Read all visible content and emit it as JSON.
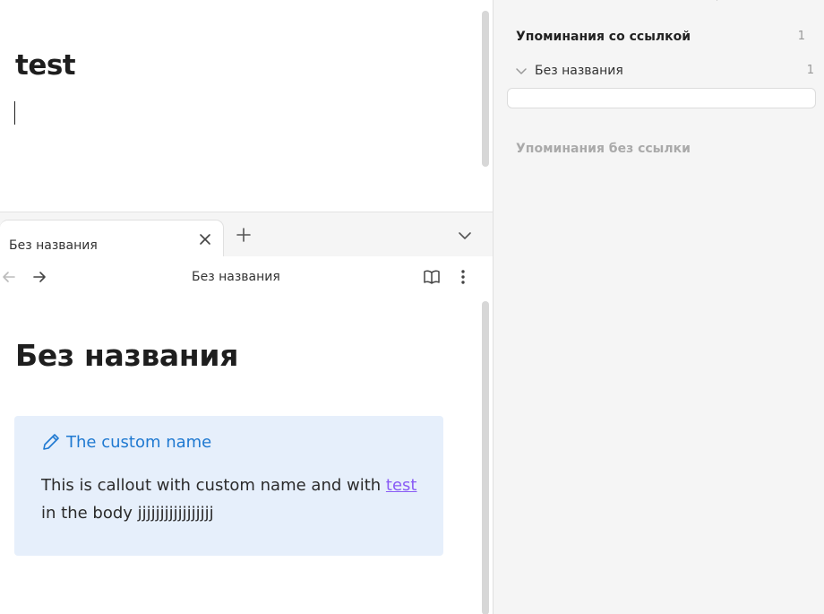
{
  "top_pane": {
    "title": "test"
  },
  "tabs": [
    {
      "label": "Без названия"
    }
  ],
  "nav": {
    "title": "Без названия"
  },
  "document": {
    "title": "Без названия",
    "callout": {
      "title": "The custom name",
      "body_before": "This is callout with custom name and with ",
      "link": "test",
      "body_after": " in the body jjjjjjjjjjjjjjjjj"
    }
  },
  "backlinks": {
    "linked_header": "Упоминания со ссылкой",
    "linked_count": "1",
    "groups": [
      {
        "label": "Без названия",
        "count": "1"
      }
    ],
    "unlinked_header": "Упоминания без ссылки"
  },
  "colors": {
    "accent_blue": "#1f79d1",
    "link_purple": "#8a5cf5",
    "callout_bg": "#e6effb"
  }
}
